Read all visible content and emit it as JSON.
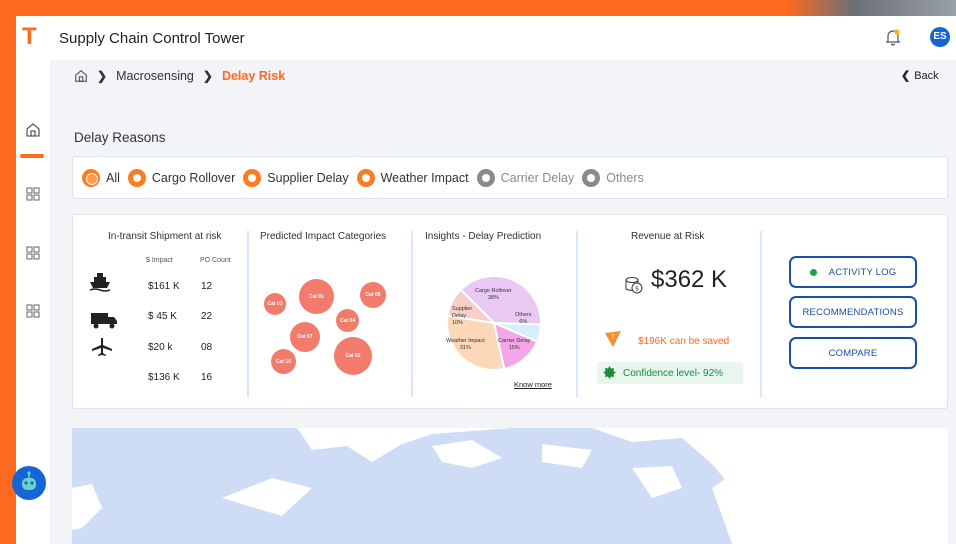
{
  "app": {
    "logo": "T",
    "title": "Supply Chain Control Tower",
    "user_initials": "ES"
  },
  "breadcrumb": {
    "level1": "Macrosensing",
    "level2": "Delay Risk"
  },
  "back_label": "Back",
  "section_title": "Delay Reasons",
  "filters": [
    {
      "label": "All",
      "state": "all"
    },
    {
      "label": "Cargo Rollover",
      "state": "on"
    },
    {
      "label": "Supplier Delay",
      "state": "on"
    },
    {
      "label": "Weather Impact",
      "state": "on"
    },
    {
      "label": "Carrier Delay",
      "state": "off"
    },
    {
      "label": "Others",
      "state": "off"
    }
  ],
  "in_transit": {
    "title": "In-transit Shipment at risk",
    "col_impact": "$ Impact",
    "col_po": "PO Count",
    "rows": [
      {
        "mode": "ship-icon",
        "impact": "$161 K",
        "po": "12"
      },
      {
        "mode": "truck-icon",
        "impact": "$ 45 K",
        "po": "22"
      },
      {
        "mode": "plane-icon",
        "impact": "$20 k",
        "po": "08"
      },
      {
        "mode": "",
        "impact": "$136 K",
        "po": "16"
      }
    ]
  },
  "impact_categories": {
    "title": "Predicted Impact Categories",
    "bubbles": [
      "Cat 01",
      "Cat 03",
      "Cat 04",
      "Cat 05",
      "Cat 07",
      "Cat 02",
      "Cat 10"
    ]
  },
  "insights": {
    "title": "Insights - Delay Prediction",
    "slices": [
      {
        "label": "Cargo Rollover",
        "value": "38%",
        "color": "#e7c9f3"
      },
      {
        "label": "Others",
        "value": "6%",
        "color": "#d6eef9"
      },
      {
        "label": "Carrier Delay",
        "value": "15%",
        "color": "#f4a6e9"
      },
      {
        "label": "Weather Impact",
        "value": "31%",
        "color": "#fcd7b8"
      },
      {
        "label": "Supplier Delay",
        "value": "10%",
        "color": "#f7cfc9"
      }
    ],
    "know_more": "Know more"
  },
  "revenue": {
    "title": "Revenue at Risk",
    "value": "$362 K",
    "saved": "$196K can be saved",
    "confidence": "Confidence level- 92%"
  },
  "actions": {
    "activity_log": "ACTIVITY LOG",
    "recommendations": "RECOMMENDATIONS",
    "compare": "COMPARE"
  },
  "colors": {
    "brand": "#ff6a1f",
    "primary": "#1a4fa8",
    "bubble": "#f37b6b",
    "map_land": "#cfdcf6"
  }
}
